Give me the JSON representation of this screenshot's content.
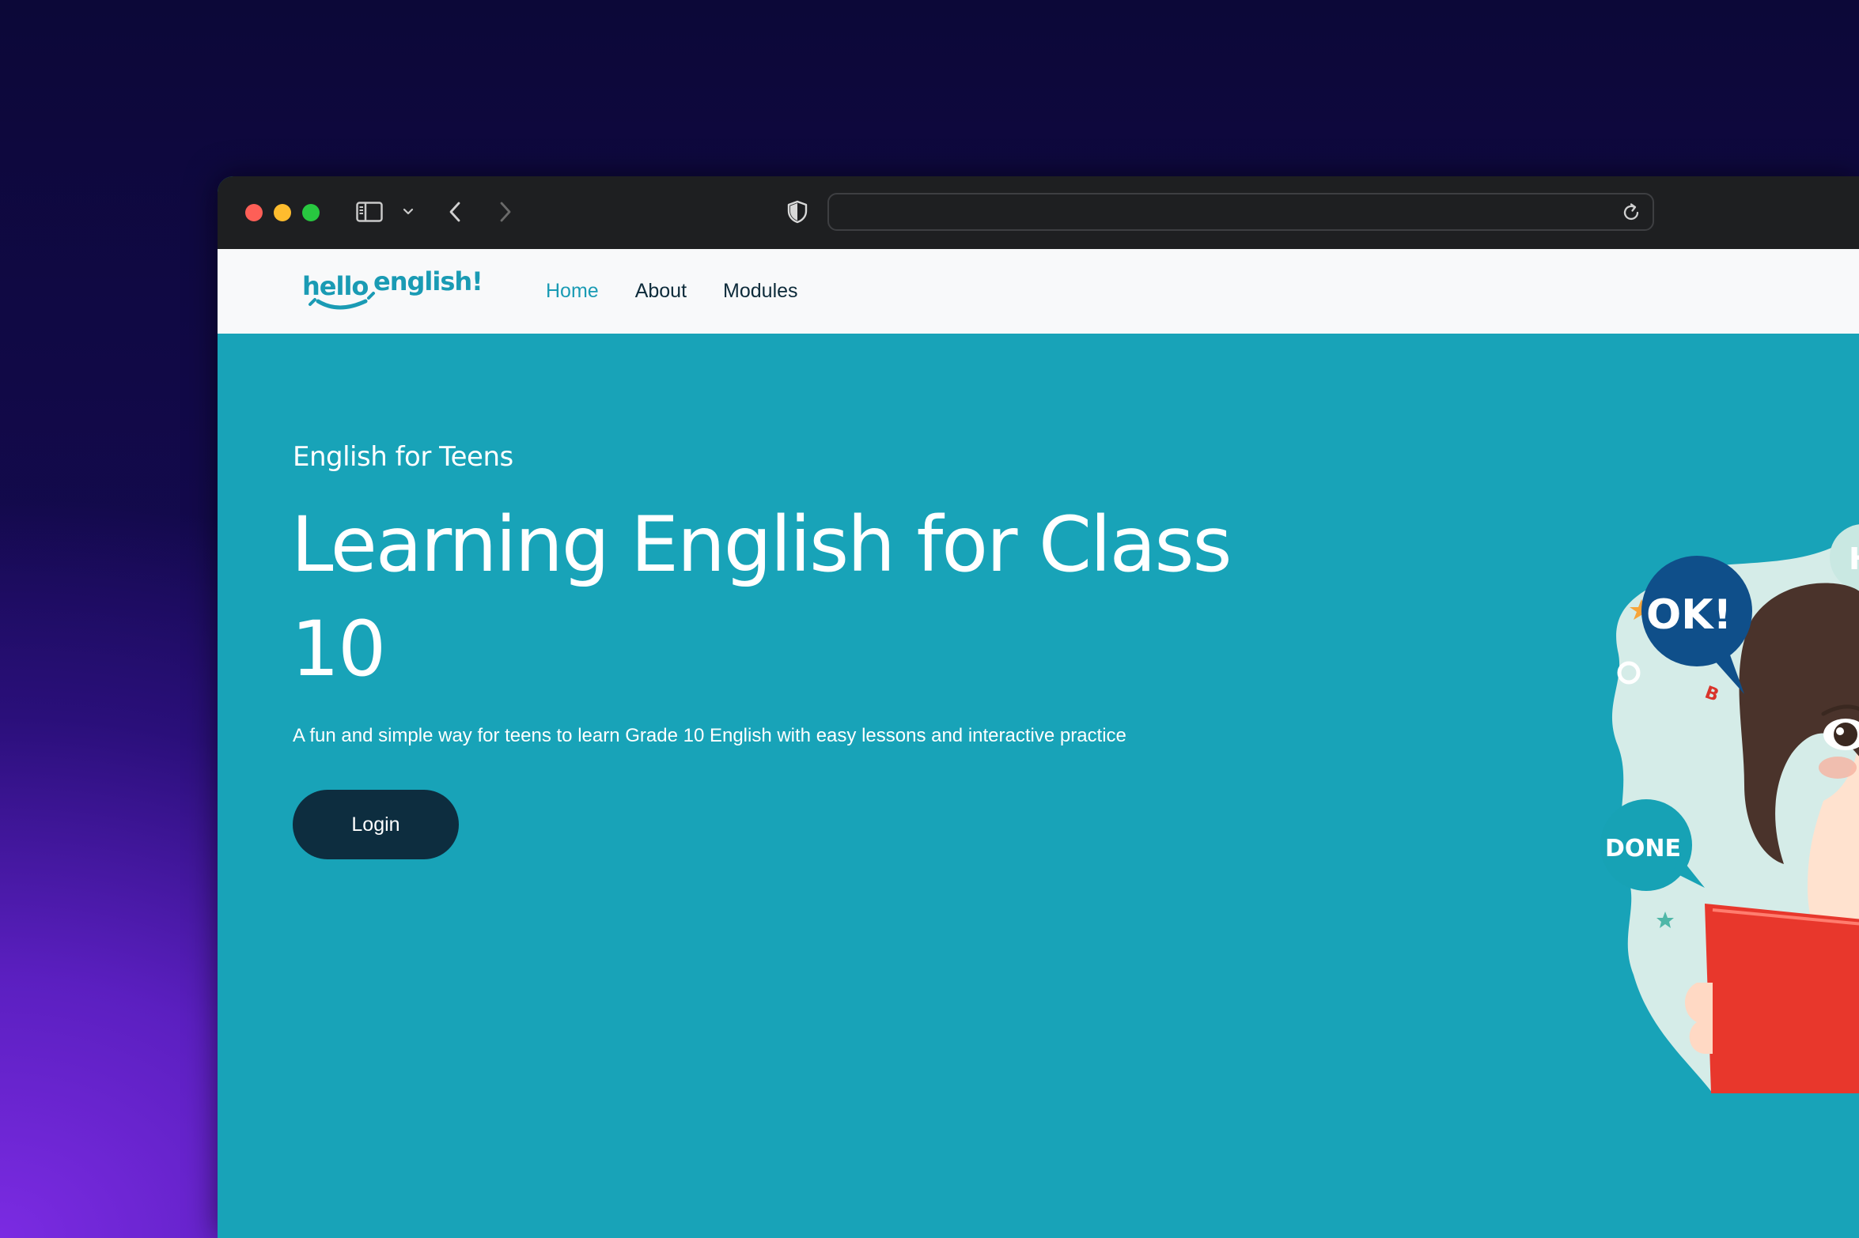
{
  "browser": {
    "address_text": ""
  },
  "site": {
    "logo_text": "hello english!",
    "nav": [
      {
        "label": "Home",
        "active": true
      },
      {
        "label": "About",
        "active": false
      },
      {
        "label": "Modules",
        "active": false
      }
    ]
  },
  "hero": {
    "eyebrow": "English for Teens",
    "headline": "Learning English for Class 10",
    "subtitle": "A fun and simple way for teens to learn Grade 10 English with easy lessons and interactive practice",
    "login_label": "Login"
  },
  "illustration": {
    "bubble_ok": "OK!",
    "bubble_done": "DONE",
    "bubble_partial": "H",
    "letter_mark": "B"
  },
  "colors": {
    "hero_bg": "#18a3b8",
    "nav_bg": "#f8f9fa",
    "nav_active": "#1a9bb4",
    "button_bg": "#0d2d3f",
    "titlebar_bg": "#1e1f21"
  }
}
